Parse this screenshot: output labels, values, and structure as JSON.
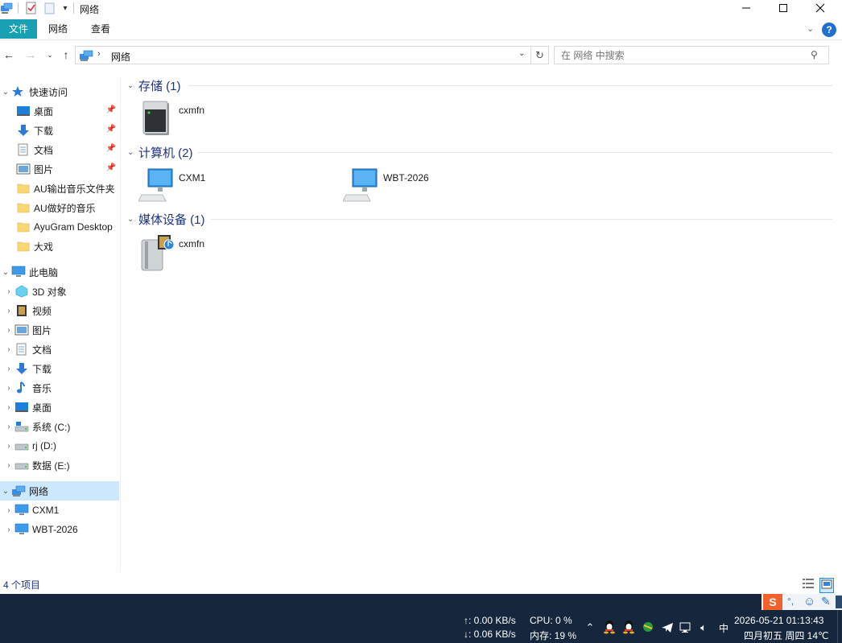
{
  "window": {
    "title": "网络"
  },
  "ribbon": {
    "tabs": [
      "文件",
      "网络",
      "查看"
    ]
  },
  "address": {
    "path": "网络",
    "search_placeholder": "在 网络 中搜索"
  },
  "sidebar": {
    "quick_access": {
      "label": "快速访问",
      "items": [
        {
          "label": "桌面",
          "pinned": true,
          "icon": "desktop-icon"
        },
        {
          "label": "下载",
          "pinned": true,
          "icon": "download-icon"
        },
        {
          "label": "文档",
          "pinned": true,
          "icon": "document-icon"
        },
        {
          "label": "图片",
          "pinned": true,
          "icon": "pictures-icon"
        },
        {
          "label": "AU输出音乐文件夹",
          "pinned": false,
          "icon": "folder-icon"
        },
        {
          "label": "AU做好的音乐",
          "pinned": false,
          "icon": "folder-icon"
        },
        {
          "label": "AyuGram Desktop",
          "pinned": false,
          "icon": "folder-icon"
        },
        {
          "label": "大戏",
          "pinned": false,
          "icon": "folder-icon"
        }
      ]
    },
    "this_pc": {
      "label": "此电脑",
      "items": [
        {
          "label": "3D 对象",
          "icon": "3d-objects-icon"
        },
        {
          "label": "视频",
          "icon": "video-icon"
        },
        {
          "label": "图片",
          "icon": "pictures-icon"
        },
        {
          "label": "文档",
          "icon": "document-icon"
        },
        {
          "label": "下载",
          "icon": "download-icon"
        },
        {
          "label": "音乐",
          "icon": "music-icon"
        },
        {
          "label": "桌面",
          "icon": "desktop-icon"
        },
        {
          "label": "系统 (C:)",
          "icon": "drive-c-icon"
        },
        {
          "label": "rj (D:)",
          "icon": "drive-icon"
        },
        {
          "label": "数据 (E:)",
          "icon": "drive-icon"
        }
      ]
    },
    "network": {
      "label": "网络",
      "items": [
        {
          "label": "CXM1",
          "icon": "computer-icon"
        },
        {
          "label": "WBT-2026",
          "icon": "computer-icon"
        }
      ]
    }
  },
  "content": {
    "groups": [
      {
        "title": "存储 (1)",
        "items": [
          {
            "name": "cxmfn",
            "icon": "nas-storage-icon"
          }
        ]
      },
      {
        "title": "计算机 (2)",
        "items": [
          {
            "name": "CXM1",
            "icon": "computer-icon"
          },
          {
            "name": "WBT-2026",
            "icon": "computer-icon"
          }
        ]
      },
      {
        "title": "媒体设备 (1)",
        "items": [
          {
            "name": "cxmfn",
            "icon": "media-device-icon"
          }
        ]
      }
    ]
  },
  "status": {
    "count": "4 个项目"
  },
  "taskbar": {
    "net_up": "↑: 0.00 KB/s",
    "net_down": "↓: 0.06 KB/s",
    "cpu": "CPU: 0 %",
    "mem": "内存: 19 %",
    "ime": "中",
    "datetime": "2026-05-21 01:13:43",
    "date_extra": "四月初五 周四 14℃"
  },
  "colors": {
    "accent": "#19a1b3",
    "group_title": "#1e3287",
    "taskbar": "#15263d",
    "selection": "#cce8ff"
  }
}
